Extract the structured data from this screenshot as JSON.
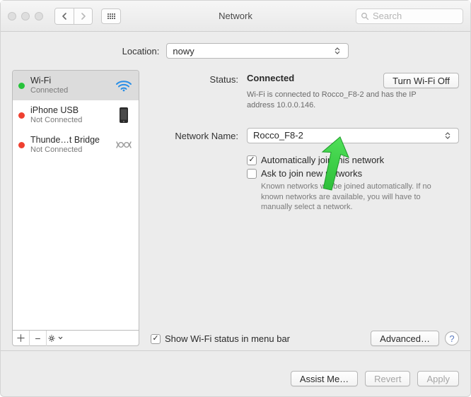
{
  "window": {
    "title": "Network"
  },
  "search": {
    "placeholder": "Search"
  },
  "location": {
    "label": "Location:",
    "value": "nowy"
  },
  "sidebar": {
    "items": [
      {
        "name": "Wi-Fi",
        "status": "Connected"
      },
      {
        "name": "iPhone USB",
        "status": "Not Connected"
      },
      {
        "name": "Thunde…t Bridge",
        "status": "Not Connected"
      }
    ]
  },
  "main": {
    "status_label": "Status:",
    "status_value": "Connected",
    "wifi_off_button": "Turn Wi-Fi Off",
    "status_desc": "Wi-Fi is connected to Rocco_F8-2 and has the IP address 10.0.0.146.",
    "network_name_label": "Network Name:",
    "network_name_value": "Rocco_F8-2",
    "auto_join_label": "Automatically join this network",
    "ask_new_label": "Ask to join new networks",
    "ask_new_desc": "Known networks will be joined automatically. If no known networks are available, you will have to manually select a network.",
    "show_menu_label": "Show Wi-Fi status in menu bar",
    "advanced_button": "Advanced…"
  },
  "footer": {
    "assist": "Assist Me…",
    "revert": "Revert",
    "apply": "Apply"
  }
}
